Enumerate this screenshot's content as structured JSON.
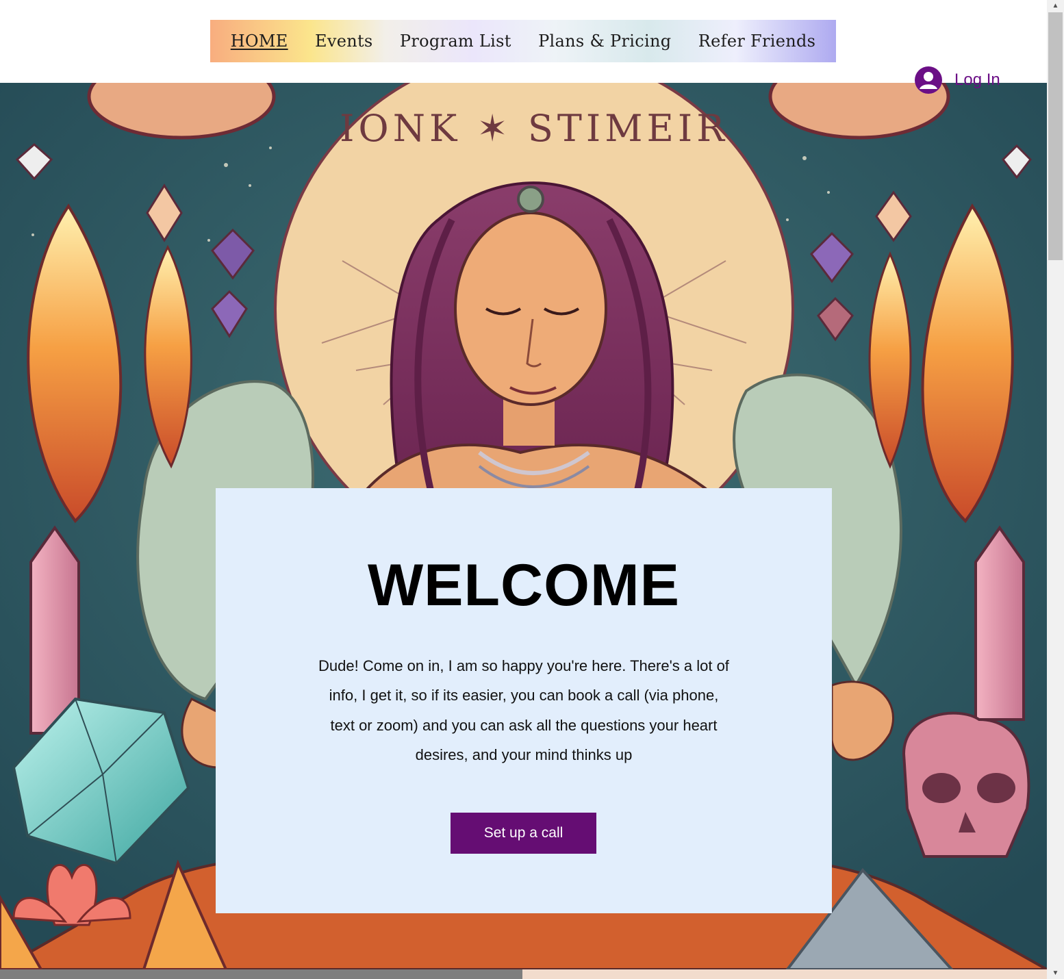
{
  "nav": {
    "items": [
      {
        "label": "HOME",
        "active": true
      },
      {
        "label": "Events"
      },
      {
        "label": "Program List"
      },
      {
        "label": "Plans & Pricing"
      },
      {
        "label": "Refer Friends"
      }
    ]
  },
  "login": {
    "label": "Log In",
    "icon": "user-avatar-icon",
    "color": "#6b0f86"
  },
  "hero": {
    "image": "illustration of a meditating woman with crystals, skull and lanterns",
    "circle_lettering": "IONK ✶ STIMEIR"
  },
  "card": {
    "title": "WELCOME",
    "text": "Dude! Come on in, I am so happy you're here. There's a lot of info, I get it, so if its easier, you can book a call (via phone, text or zoom) and you can ask all the questions your heart desires, and your mind thinks up",
    "cta": "Set up a call",
    "background": "#e2eefc",
    "cta_color": "#650d73"
  },
  "scrollbar": {
    "up_icon": "scroll-up-arrow-icon",
    "down_icon": "scroll-down-arrow-icon"
  }
}
